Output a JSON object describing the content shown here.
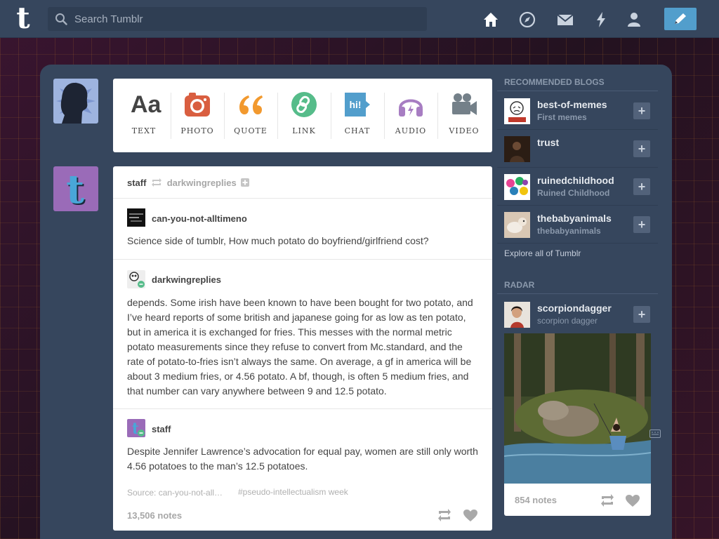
{
  "topbar": {
    "logo": "t",
    "search_placeholder": "Search Tumblr",
    "nav": [
      "home-icon",
      "explore-icon",
      "inbox-icon",
      "activity-icon",
      "account-icon"
    ],
    "compose_icon": "pencil-icon"
  },
  "post_types": [
    {
      "label": "TEXT",
      "icon": "text-icon",
      "color": "#444444",
      "glyph": "Aa"
    },
    {
      "label": "PHOTO",
      "icon": "camera-icon",
      "color": "#d95e40"
    },
    {
      "label": "QUOTE",
      "icon": "quote-icon",
      "color": "#f2992e",
      "glyph": "“"
    },
    {
      "label": "LINK",
      "icon": "link-icon",
      "color": "#56bc8a"
    },
    {
      "label": "CHAT",
      "icon": "chat-icon",
      "color": "#529ecc",
      "glyph": "hi!"
    },
    {
      "label": "AUDIO",
      "icon": "headphones-icon",
      "color": "#a77dc2"
    },
    {
      "label": "VIDEO",
      "icon": "video-icon",
      "color": "#748089"
    }
  ],
  "post": {
    "author": "staff",
    "reblogged_from": "darkwingreplies",
    "blocks": [
      {
        "user": "can-you-not-alltimeno",
        "text": "Science side of tumblr, How much potato do boyfriend/girlfriend cost?"
      },
      {
        "user": "darkwingreplies",
        "text": "depends. Some irish have been known to have been bought for two potato, and I’ve heard reports of some british and japanese going for as low as ten potato, but in america it is exchanged for fries. This messes with the normal metric potato measurements since they refuse to convert from Mc.standard, and the rate of potato-to-fries isn’t always the same. On average, a gf in america will be about 3 medium fries, or 4.56 potato. A bf, though, is often 5 medium fries, and that number can vary anywhere between 9 and 12.5 potato."
      },
      {
        "user": "staff",
        "text": "Despite Jennifer Lawrence’s advocation for equal pay, women are still only worth 4.56 potatoes to the man’s 12.5 potatoes."
      }
    ],
    "source": "Source: can-you-not-all…",
    "tag": "#pseudo-intellectualism week",
    "notes": "13,506 notes"
  },
  "sidebar": {
    "recommended_title": "RECOMMENDED BLOGS",
    "blogs": [
      {
        "name": "best-of-memes",
        "sub": "First memes"
      },
      {
        "name": "trust",
        "sub": ""
      },
      {
        "name": "ruinedchildhood",
        "sub": "Ruined Childhood"
      },
      {
        "name": "thebabyanimals",
        "sub": "thebabyanimals"
      }
    ],
    "explore": "Explore all of Tumblr",
    "radar_title": "RADAR",
    "radar": {
      "name": "scorpiondagger",
      "sub": "scorpion dagger",
      "notes": "854 notes"
    }
  }
}
